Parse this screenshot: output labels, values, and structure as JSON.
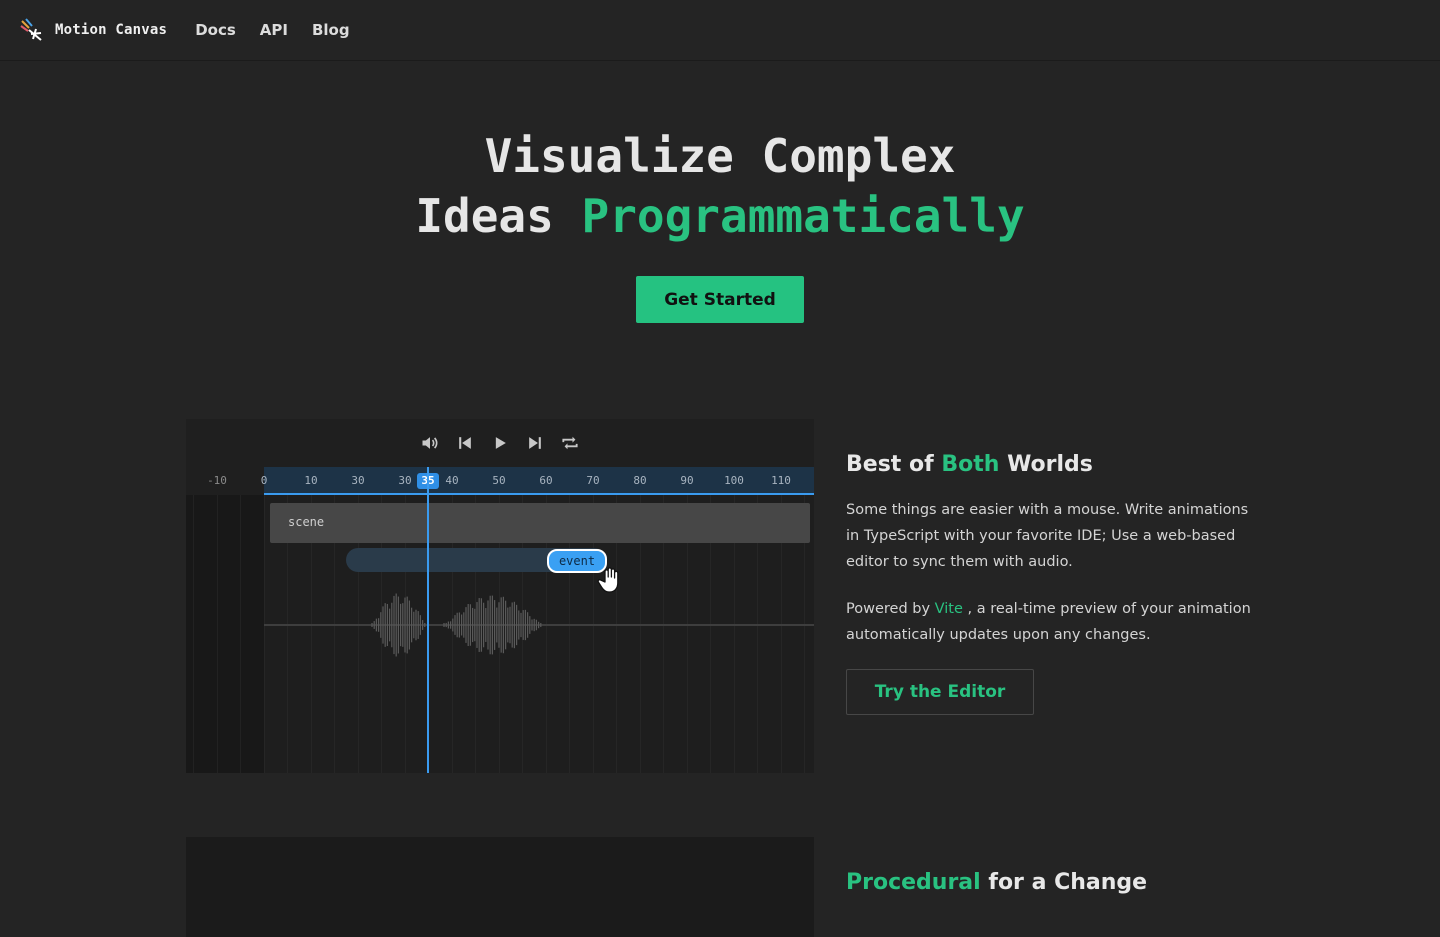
{
  "nav": {
    "brand": "Motion Canvas",
    "links": [
      "Docs",
      "API",
      "Blog"
    ]
  },
  "hero": {
    "title_line1": "Visualize Complex",
    "title_line2_plain": "Ideas",
    "title_line2_accent": "Programmatically",
    "cta_label": "Get Started"
  },
  "editor": {
    "controls": [
      "volume-icon",
      "skip-back-icon",
      "play-icon",
      "skip-forward-icon",
      "loop-icon"
    ],
    "ruler_ticks": [
      "-10",
      "0",
      "10",
      "30",
      "30",
      "40",
      "50",
      "60",
      "70",
      "80",
      "90",
      "100",
      "110"
    ],
    "playhead": "35",
    "scene_label": "scene",
    "event_label": "event"
  },
  "feature1": {
    "title_a": "Best of",
    "title_accent": "Both",
    "title_b": "Worlds",
    "p1": "Some things are easier with a mouse. Write animations in TypeScript with your favorite IDE; Use a web-based editor to sync them with audio.",
    "p2_a": "Powered by",
    "p2_link": "Vite",
    "p2_b": ", a real-time preview of your animation automatically updates upon any changes.",
    "button": "Try the Editor"
  },
  "feature2": {
    "title_accent": "Procedural",
    "title_b": "for a Change"
  },
  "colors": {
    "accent": "#29c281",
    "background": "#242424",
    "timeline_blue": "#3a9bf0"
  }
}
